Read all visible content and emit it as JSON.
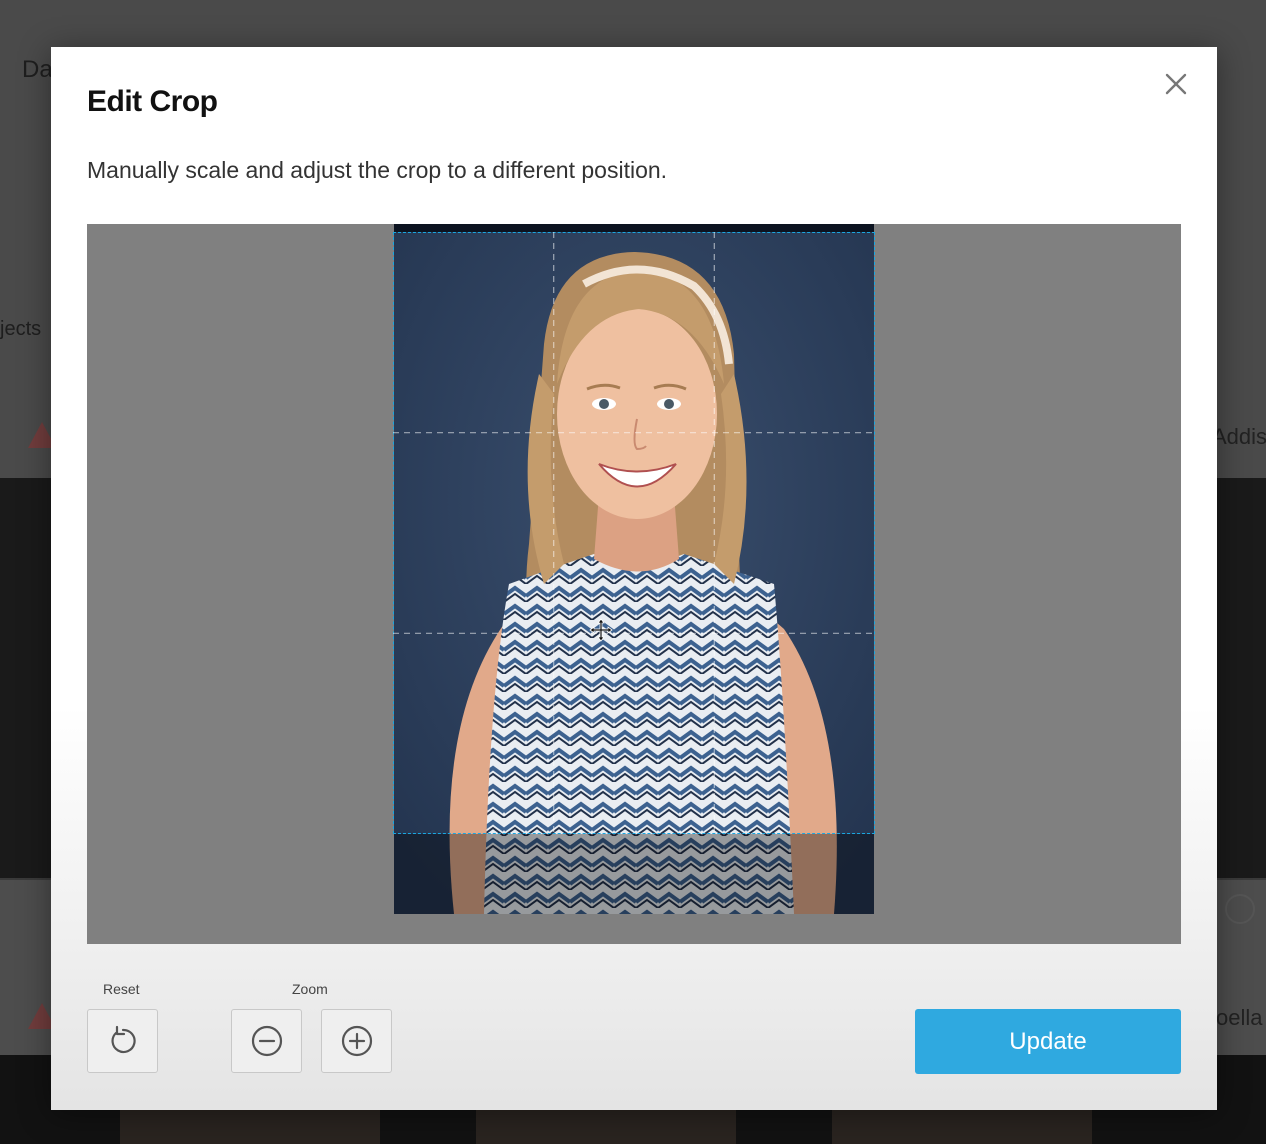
{
  "background": {
    "top_left_text": "Da",
    "left_text": "jects",
    "right_text_1": "Addis",
    "right_text_2": "oella"
  },
  "modal": {
    "title": "Edit Crop",
    "description": "Manually scale and adjust the crop to a different position.",
    "close_icon": "close-icon",
    "controls": {
      "reset_label": "Reset",
      "zoom_label": "Zoom",
      "reset_icon": "rotate-ccw-icon",
      "zoom_out_icon": "minus-circle-icon",
      "zoom_in_icon": "plus-circle-icon"
    },
    "update_label": "Update"
  },
  "colors": {
    "accent": "#2fa9e0",
    "crop_guide": "#1aa6e0",
    "crop_backdrop": "#808080"
  }
}
